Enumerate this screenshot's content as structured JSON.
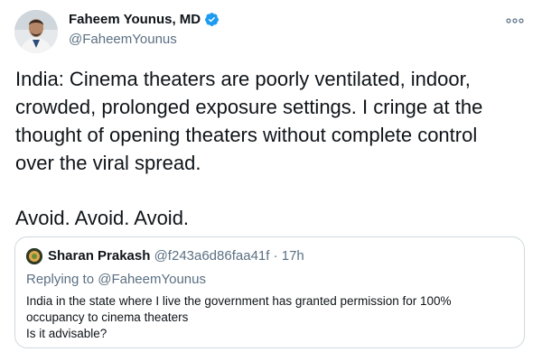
{
  "author": {
    "name": "Faheem Younus, MD",
    "handle": "@FaheemYounus",
    "verified_color": "#1d9bf0"
  },
  "tweet": {
    "lines": [
      "India: Cinema theaters are poorly ventilated, indoor,",
      "crowded, prolonged exposure settings. I cringe at the",
      "thought of opening theaters without complete control",
      "over the viral spread."
    ],
    "closing": "Avoid. Avoid. Avoid."
  },
  "quoted": {
    "name": "Sharan Prakash",
    "handle_time": "@f243a6d86faa41f · 17h",
    "replying_prefix": "Replying to ",
    "replying_to": "@FaheemYounus",
    "lines": [
      "India  in the state where I live the government has granted permission for 100%",
      "occupancy to cinema theaters",
      "Is it advisable?"
    ]
  },
  "icons": {
    "more": "more-horizontal-icon",
    "verified": "verified-badge-icon"
  }
}
